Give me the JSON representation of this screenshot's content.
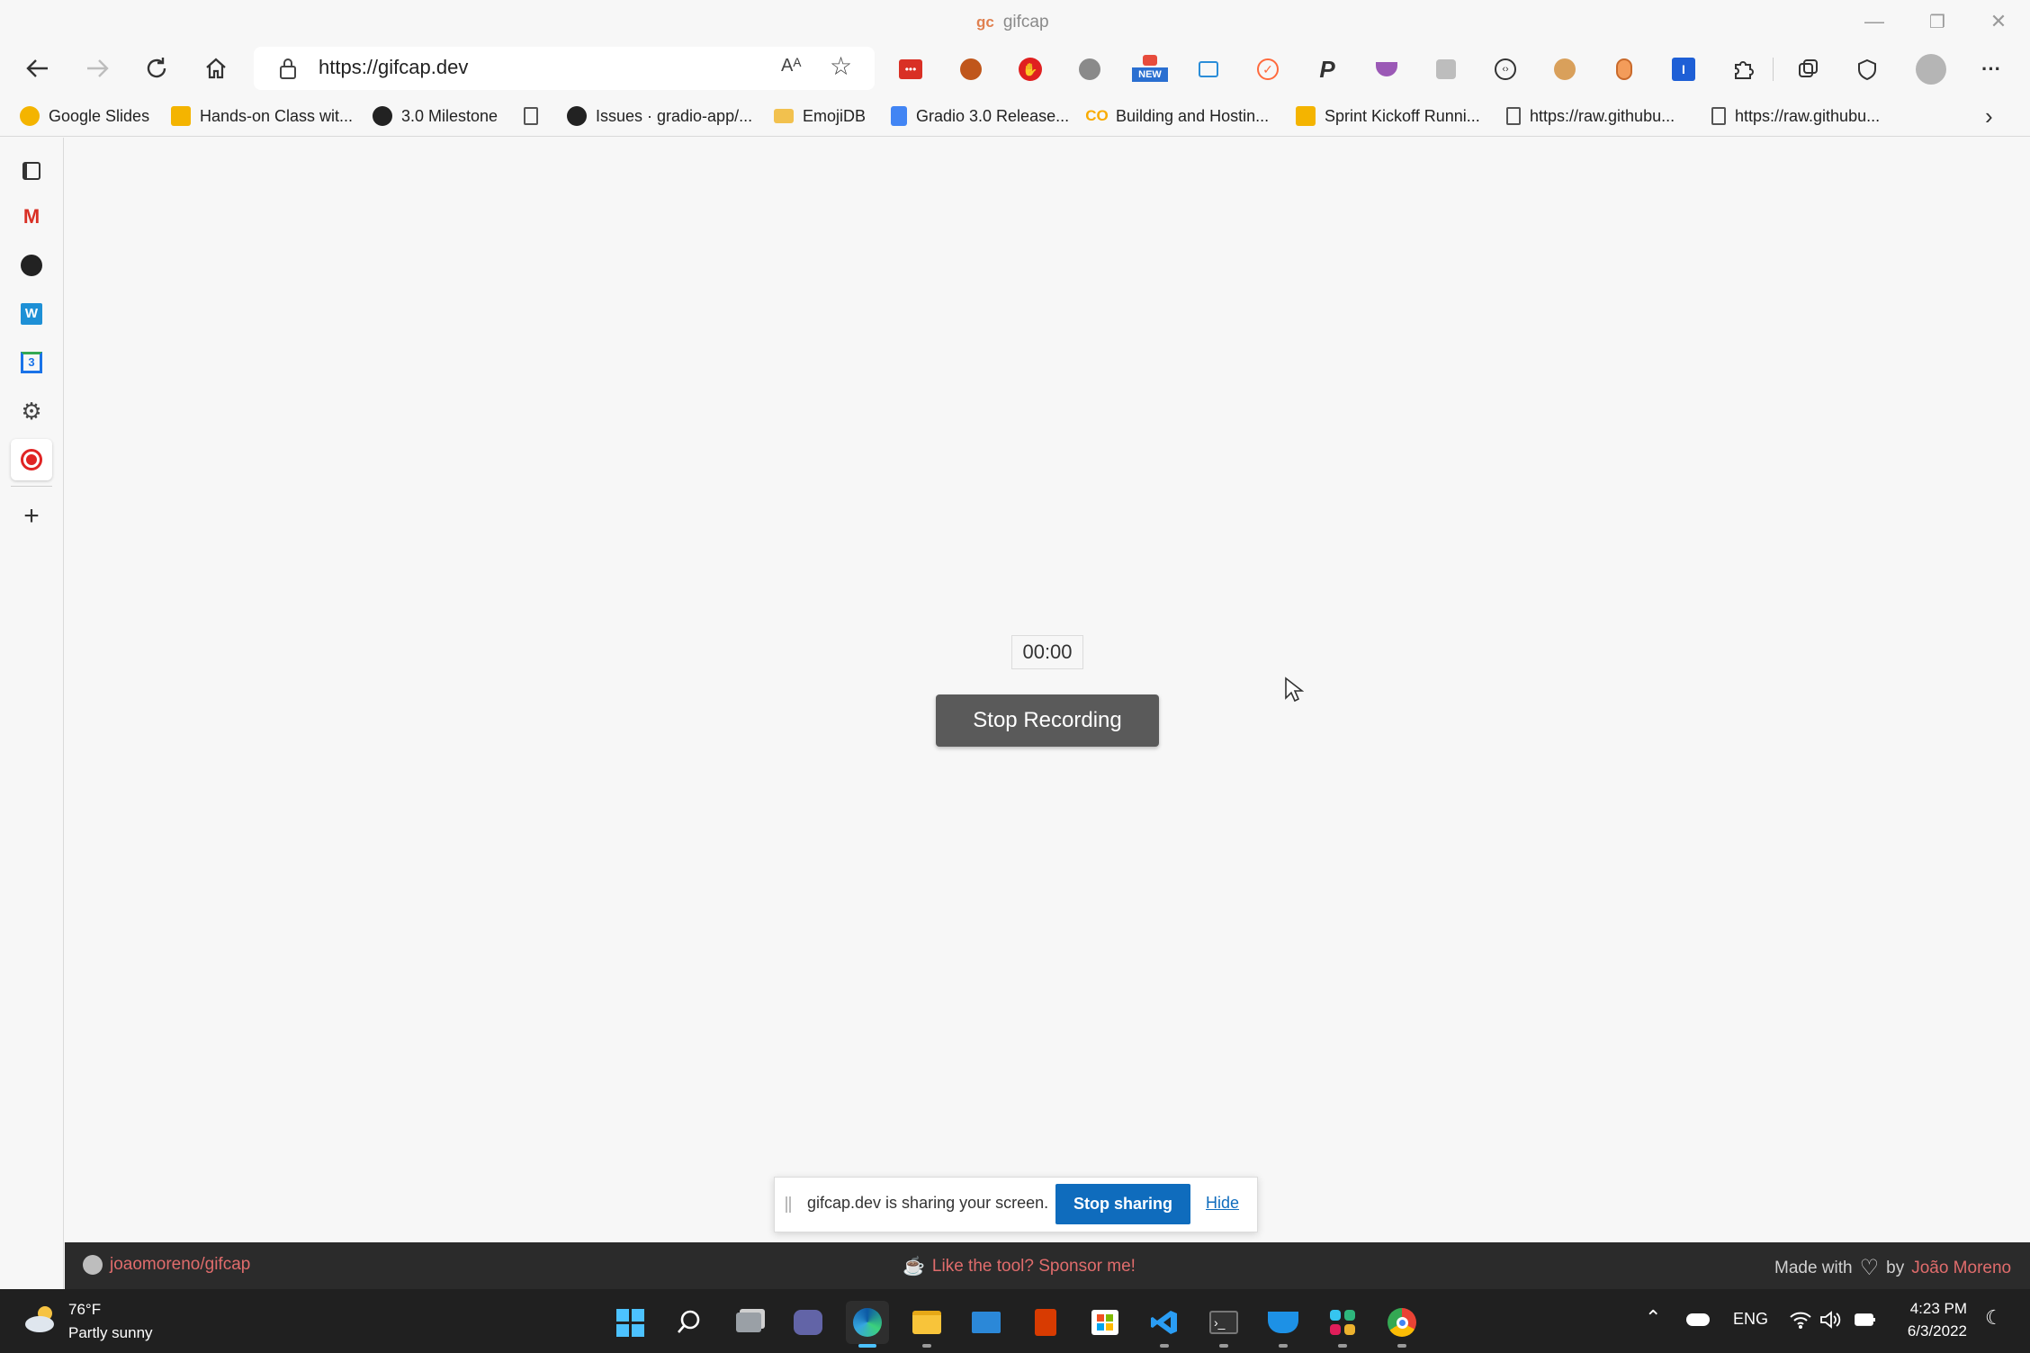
{
  "window": {
    "logo": "gc",
    "title": "gifcap",
    "controls": {
      "minimize": "—",
      "restore": "❐",
      "close": "✕"
    }
  },
  "toolbar": {
    "url": "https://gifcap.dev",
    "read_aloud": "Aᴬ",
    "favorite": "☆",
    "extension_badge": "NEW",
    "more": "···"
  },
  "bookmarks": [
    {
      "label": "Google Slides",
      "icon": "slides-icon",
      "color": "#f4b400"
    },
    {
      "label": "Hands-on Class wit...",
      "icon": "slides-icon",
      "color": "#f4b400"
    },
    {
      "label": "3.0 Milestone",
      "icon": "github-icon",
      "color": "#222222"
    },
    {
      "label": "",
      "icon": "page-icon",
      "color": "#555555"
    },
    {
      "label": "Issues · gradio-app/...",
      "icon": "github-icon",
      "color": "#222222"
    },
    {
      "label": "EmojiDB",
      "icon": "folder-icon",
      "color": "#f2c14e"
    },
    {
      "label": "Gradio 3.0 Release...",
      "icon": "docs-icon",
      "color": "#4285f4"
    },
    {
      "label": "Building and Hostin...",
      "icon": "co-icon",
      "color": "#f9ab00"
    },
    {
      "label": "Sprint Kickoff Runni...",
      "icon": "slides-icon",
      "color": "#f4b400"
    },
    {
      "label": "https://raw.githubu...",
      "icon": "page-icon",
      "color": "#555555"
    },
    {
      "label": "https://raw.githubu...",
      "icon": "page-icon",
      "color": "#555555"
    }
  ],
  "recording": {
    "timer": "00:00",
    "stop_button": "Stop Recording"
  },
  "share_bar": {
    "message": "gifcap.dev is sharing your screen.",
    "stop": "Stop sharing",
    "hide": "Hide"
  },
  "footer": {
    "repo": "joaomoreno/gifcap",
    "sponsor": "Like the tool? Sponsor me!",
    "made_with": "Made with",
    "by": "by",
    "author": "João Moreno",
    "link_color": "#e06c6c"
  },
  "taskbar": {
    "weather_temp": "76°F",
    "weather_desc": "Partly sunny",
    "language": "ENG",
    "time": "4:23 PM",
    "date": "6/3/2022"
  }
}
